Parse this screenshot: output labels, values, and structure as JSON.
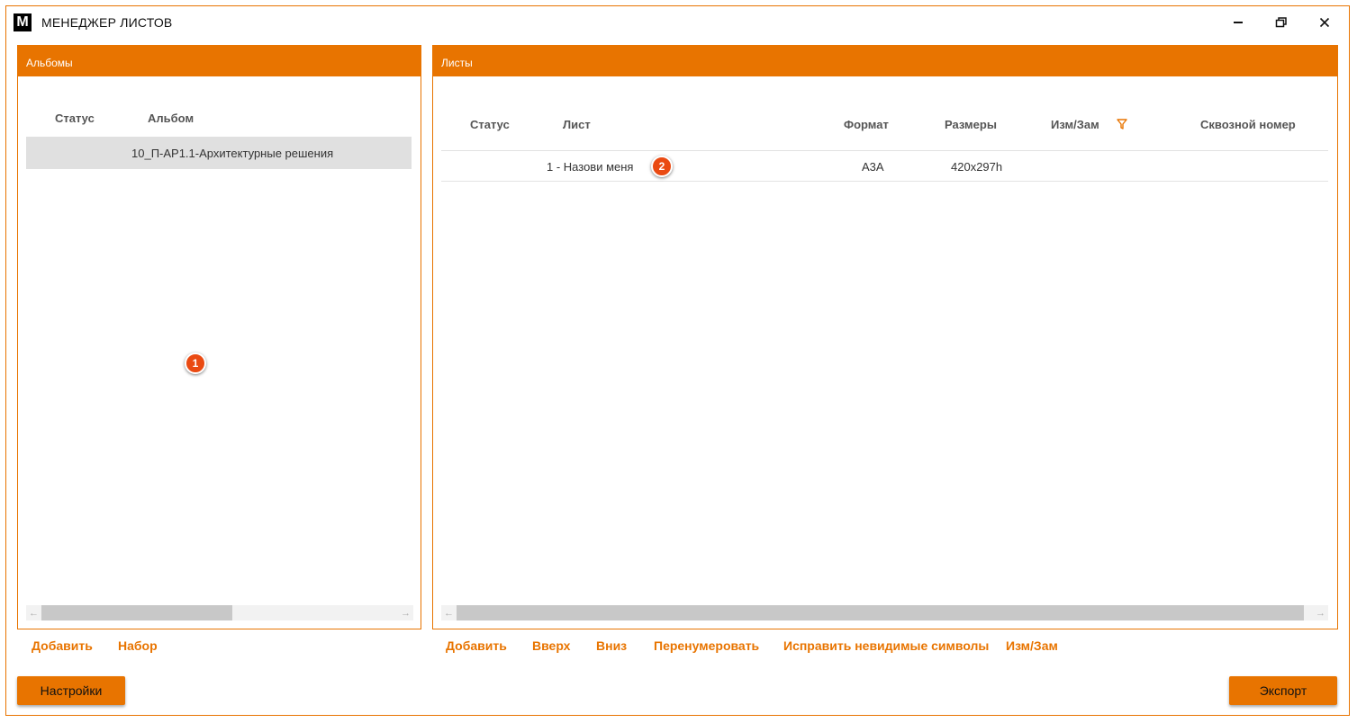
{
  "window": {
    "logo_letter": "M",
    "title": "МЕНЕДЖЕР ЛИСТОВ"
  },
  "albums_panel": {
    "header": "Альбомы",
    "columns": {
      "status": "Статус",
      "album": "Альбом"
    },
    "rows": [
      {
        "status": "",
        "album": "10_П-АР1.1-Архитектурные решения"
      }
    ],
    "badge": "1"
  },
  "sheets_panel": {
    "header": "Листы",
    "columns": {
      "status": "Статус",
      "sheet": "Лист",
      "format": "Формат",
      "size": "Размеры",
      "rev": "Изм/Зам",
      "number": "Сквозной номер"
    },
    "rows": [
      {
        "status": "",
        "sheet": "1 - Назови меня",
        "format": "А3А",
        "size": "420x297h",
        "rev": "",
        "number": ""
      }
    ],
    "badge": "2"
  },
  "album_actions": {
    "add": "Добавить",
    "set": "Набор"
  },
  "sheet_actions": {
    "add": "Добавить",
    "up": "Вверх",
    "down": "Вниз",
    "renumber": "Перенумеровать",
    "fix_invisible": "Исправить невидимые символы",
    "rev": "Изм/Зам"
  },
  "footer": {
    "settings": "Настройки",
    "export": "Экспорт"
  },
  "colors": {
    "accent": "#e87400",
    "badge": "#ea4a12",
    "row_selected": "#e0e0e0"
  },
  "icons": [
    "minimize-icon",
    "maximize-icon",
    "close-icon",
    "filter-icon",
    "arrow-left-icon",
    "arrow-right-icon"
  ]
}
